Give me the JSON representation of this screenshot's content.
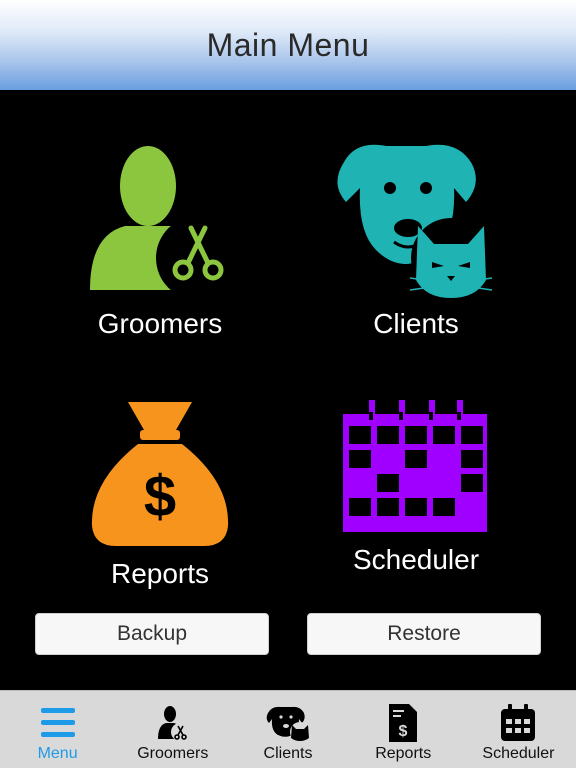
{
  "header": {
    "title": "Main Menu"
  },
  "tiles": [
    {
      "label": "Groomers",
      "icon": "groomer-scissors-icon",
      "color": "#8cc63f"
    },
    {
      "label": "Clients",
      "icon": "dog-cat-icon",
      "color": "#1fb3b3"
    },
    {
      "label": "Reports",
      "icon": "money-bag-icon",
      "color": "#f7941d"
    },
    {
      "label": "Scheduler",
      "icon": "calendar-grid-icon",
      "color": "#a000ff"
    }
  ],
  "buttons": {
    "backup": "Backup",
    "restore": "Restore"
  },
  "tabs": [
    {
      "label": "Menu",
      "icon": "menu-icon",
      "active": true
    },
    {
      "label": "Groomers",
      "icon": "groomer-icon"
    },
    {
      "label": "Clients",
      "icon": "pets-icon"
    },
    {
      "label": "Reports",
      "icon": "report-icon"
    },
    {
      "label": "Scheduler",
      "icon": "calendar-icon"
    }
  ],
  "colors": {
    "active_tab": "#1e9be8",
    "tabbar_bg": "#d9d9d9"
  }
}
